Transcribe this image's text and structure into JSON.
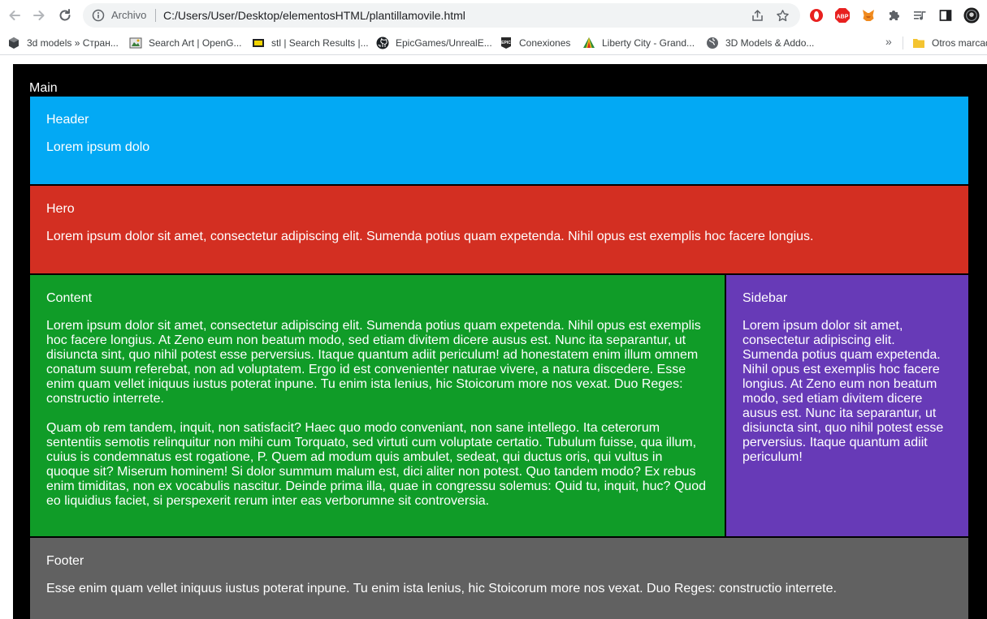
{
  "browser": {
    "omnibox_label": "Archivo",
    "url": "C:/Users/User/Desktop/elementosHTML/plantillamovile.html",
    "bookmarks": [
      {
        "label": "3d models » Стран...",
        "icon": "cube-icon"
      },
      {
        "label": "Search Art | OpenG...",
        "icon": "opengameart-icon"
      },
      {
        "label": "stl | Search Results |...",
        "icon": "stl-icon"
      },
      {
        "label": "EpicGames/UnrealE...",
        "icon": "github-icon"
      },
      {
        "label": "Conexiones",
        "icon": "epic-icon"
      },
      {
        "label": "Liberty City - Grand...",
        "icon": "pyramid-icon"
      },
      {
        "label": "3D Models & Addo...",
        "icon": "globe-icon"
      }
    ],
    "overflow_chevron": "»",
    "other_bookmarks": "Otros marcad"
  },
  "page": {
    "main_label": "Main",
    "header": {
      "title": "Header",
      "text": "Lorem ipsum dolo"
    },
    "hero": {
      "title": "Hero",
      "text": "Lorem ipsum dolor sit amet, consectetur adipiscing elit. Sumenda potius quam expetenda. Nihil opus est exemplis hoc facere longius."
    },
    "content": {
      "title": "Content",
      "p1": "Lorem ipsum dolor sit amet, consectetur adipiscing elit. Sumenda potius quam expetenda. Nihil opus est exemplis hoc facere longius. At Zeno eum non beatum modo, sed etiam divitem dicere ausus est. Nunc ita separantur, ut disiuncta sint, quo nihil potest esse perversius. Itaque quantum adiit periculum! ad honestatem enim illum omnem conatum suum referebat, non ad voluptatem. Ergo id est convenienter naturae vivere, a natura discedere. Esse enim quam vellet iniquus iustus poterat inpune. Tu enim ista lenius, hic Stoicorum more nos vexat. Duo Reges: constructio interrete.",
      "p2": "Quam ob rem tandem, inquit, non satisfacit? Haec quo modo conveniant, non sane intellego. Ita ceterorum sententiis semotis relinquitur non mihi cum Torquato, sed virtuti cum voluptate certatio. Tubulum fuisse, qua illum, cuius is condemnatus est rogatione, P. Quem ad modum quis ambulet, sedeat, qui ductus oris, qui vultus in quoque sit? Miserum hominem! Si dolor summum malum est, dici aliter non potest. Quo tandem modo? Ex rebus enim timiditas, non ex vocabulis nascitur. Deinde prima illa, quae in congressu solemus: Quid tu, inquit, huc? Quod eo liquidius faciet, si perspexerit rerum inter eas verborumne sit controversia."
    },
    "sidebar": {
      "title": "Sidebar",
      "text": "Lorem ipsum dolor sit amet, consectetur adipiscing elit. Sumenda potius quam expetenda. Nihil opus est exemplis hoc facere longius. At Zeno eum non beatum modo, sed etiam divitem dicere ausus est. Nunc ita separantur, ut disiuncta sint, quo nihil potest esse perversius. Itaque quantum adiit periculum!"
    },
    "footer": {
      "title": "Footer",
      "text": "Esse enim quam vellet iniquus iustus poterat inpune. Tu enim ista lenius, hic Stoicorum more nos vexat. Duo Reges: constructio interrete."
    }
  },
  "colors": {
    "header": "#03a9f4",
    "hero": "#d32f22",
    "content": "#109c28",
    "sidebar": "#673ab7",
    "footer": "#616161",
    "main": "#000000"
  }
}
